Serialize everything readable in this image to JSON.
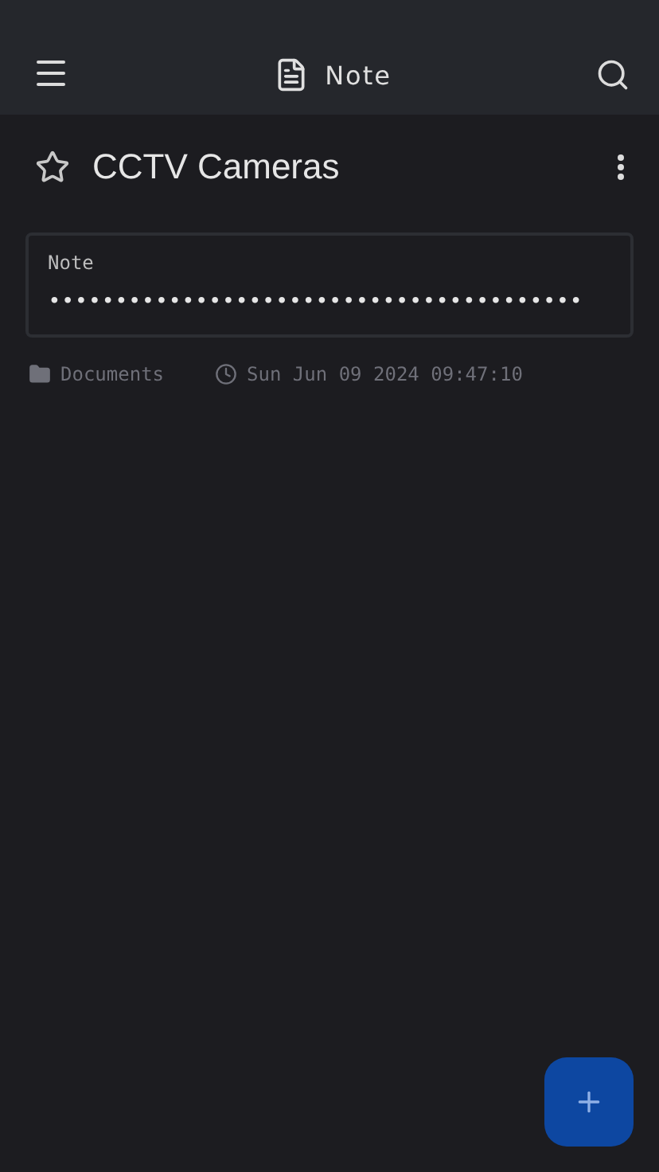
{
  "app_bar": {
    "title": "Note"
  },
  "note": {
    "title": "CCTV Cameras",
    "favorite": false,
    "field": {
      "label": "Note",
      "value": "••••••••••••••••••••••••••••••••••••••••"
    },
    "folder": "Documents",
    "modified": "Sun Jun 09 2024 09:47:10"
  }
}
